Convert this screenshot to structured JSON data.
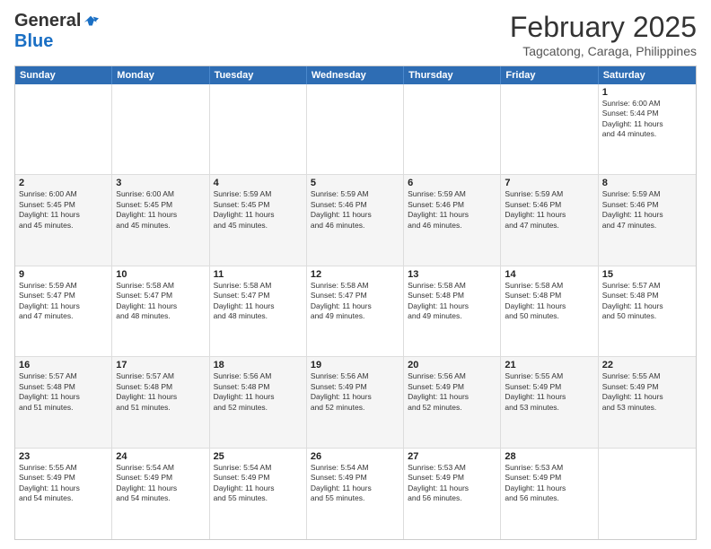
{
  "header": {
    "logo": {
      "general": "General",
      "blue": "Blue"
    },
    "month": "February 2025",
    "location": "Tagcatong, Caraga, Philippines"
  },
  "days_of_week": [
    "Sunday",
    "Monday",
    "Tuesday",
    "Wednesday",
    "Thursday",
    "Friday",
    "Saturday"
  ],
  "weeks": [
    [
      {
        "day": "",
        "info": ""
      },
      {
        "day": "",
        "info": ""
      },
      {
        "day": "",
        "info": ""
      },
      {
        "day": "",
        "info": ""
      },
      {
        "day": "",
        "info": ""
      },
      {
        "day": "",
        "info": ""
      },
      {
        "day": "1",
        "info": "Sunrise: 6:00 AM\nSunset: 5:44 PM\nDaylight: 11 hours\nand 44 minutes."
      }
    ],
    [
      {
        "day": "2",
        "info": "Sunrise: 6:00 AM\nSunset: 5:45 PM\nDaylight: 11 hours\nand 45 minutes."
      },
      {
        "day": "3",
        "info": "Sunrise: 6:00 AM\nSunset: 5:45 PM\nDaylight: 11 hours\nand 45 minutes."
      },
      {
        "day": "4",
        "info": "Sunrise: 5:59 AM\nSunset: 5:45 PM\nDaylight: 11 hours\nand 45 minutes."
      },
      {
        "day": "5",
        "info": "Sunrise: 5:59 AM\nSunset: 5:46 PM\nDaylight: 11 hours\nand 46 minutes."
      },
      {
        "day": "6",
        "info": "Sunrise: 5:59 AM\nSunset: 5:46 PM\nDaylight: 11 hours\nand 46 minutes."
      },
      {
        "day": "7",
        "info": "Sunrise: 5:59 AM\nSunset: 5:46 PM\nDaylight: 11 hours\nand 47 minutes."
      },
      {
        "day": "8",
        "info": "Sunrise: 5:59 AM\nSunset: 5:46 PM\nDaylight: 11 hours\nand 47 minutes."
      }
    ],
    [
      {
        "day": "9",
        "info": "Sunrise: 5:59 AM\nSunset: 5:47 PM\nDaylight: 11 hours\nand 47 minutes."
      },
      {
        "day": "10",
        "info": "Sunrise: 5:58 AM\nSunset: 5:47 PM\nDaylight: 11 hours\nand 48 minutes."
      },
      {
        "day": "11",
        "info": "Sunrise: 5:58 AM\nSunset: 5:47 PM\nDaylight: 11 hours\nand 48 minutes."
      },
      {
        "day": "12",
        "info": "Sunrise: 5:58 AM\nSunset: 5:47 PM\nDaylight: 11 hours\nand 49 minutes."
      },
      {
        "day": "13",
        "info": "Sunrise: 5:58 AM\nSunset: 5:48 PM\nDaylight: 11 hours\nand 49 minutes."
      },
      {
        "day": "14",
        "info": "Sunrise: 5:58 AM\nSunset: 5:48 PM\nDaylight: 11 hours\nand 50 minutes."
      },
      {
        "day": "15",
        "info": "Sunrise: 5:57 AM\nSunset: 5:48 PM\nDaylight: 11 hours\nand 50 minutes."
      }
    ],
    [
      {
        "day": "16",
        "info": "Sunrise: 5:57 AM\nSunset: 5:48 PM\nDaylight: 11 hours\nand 51 minutes."
      },
      {
        "day": "17",
        "info": "Sunrise: 5:57 AM\nSunset: 5:48 PM\nDaylight: 11 hours\nand 51 minutes."
      },
      {
        "day": "18",
        "info": "Sunrise: 5:56 AM\nSunset: 5:48 PM\nDaylight: 11 hours\nand 52 minutes."
      },
      {
        "day": "19",
        "info": "Sunrise: 5:56 AM\nSunset: 5:49 PM\nDaylight: 11 hours\nand 52 minutes."
      },
      {
        "day": "20",
        "info": "Sunrise: 5:56 AM\nSunset: 5:49 PM\nDaylight: 11 hours\nand 52 minutes."
      },
      {
        "day": "21",
        "info": "Sunrise: 5:55 AM\nSunset: 5:49 PM\nDaylight: 11 hours\nand 53 minutes."
      },
      {
        "day": "22",
        "info": "Sunrise: 5:55 AM\nSunset: 5:49 PM\nDaylight: 11 hours\nand 53 minutes."
      }
    ],
    [
      {
        "day": "23",
        "info": "Sunrise: 5:55 AM\nSunset: 5:49 PM\nDaylight: 11 hours\nand 54 minutes."
      },
      {
        "day": "24",
        "info": "Sunrise: 5:54 AM\nSunset: 5:49 PM\nDaylight: 11 hours\nand 54 minutes."
      },
      {
        "day": "25",
        "info": "Sunrise: 5:54 AM\nSunset: 5:49 PM\nDaylight: 11 hours\nand 55 minutes."
      },
      {
        "day": "26",
        "info": "Sunrise: 5:54 AM\nSunset: 5:49 PM\nDaylight: 11 hours\nand 55 minutes."
      },
      {
        "day": "27",
        "info": "Sunrise: 5:53 AM\nSunset: 5:49 PM\nDaylight: 11 hours\nand 56 minutes."
      },
      {
        "day": "28",
        "info": "Sunrise: 5:53 AM\nSunset: 5:49 PM\nDaylight: 11 hours\nand 56 minutes."
      },
      {
        "day": "",
        "info": ""
      }
    ]
  ]
}
